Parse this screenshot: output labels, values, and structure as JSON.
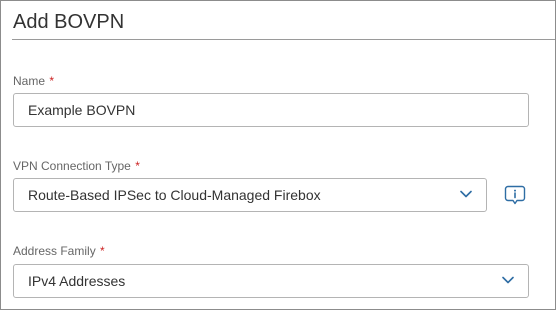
{
  "dialog": {
    "title": "Add BOVPN"
  },
  "fields": {
    "name": {
      "label": "Name",
      "required_mark": "*",
      "value": "Example BOVPN"
    },
    "vpn_connection_type": {
      "label": "VPN Connection Type",
      "required_mark": "*",
      "selected": "Route-Based IPSec to Cloud-Managed Firebox",
      "icon": "chevron-down-icon"
    },
    "address_family": {
      "label": "Address Family",
      "required_mark": "*",
      "selected": "IPv4 Addresses",
      "icon": "chevron-down-icon"
    }
  },
  "info_button": {
    "icon": "info-speech-bubble-icon"
  },
  "colors": {
    "accent": "#2e6da4",
    "required": "#cc2222",
    "label": "#666666",
    "text": "#333333",
    "border": "#b4b4b4"
  }
}
